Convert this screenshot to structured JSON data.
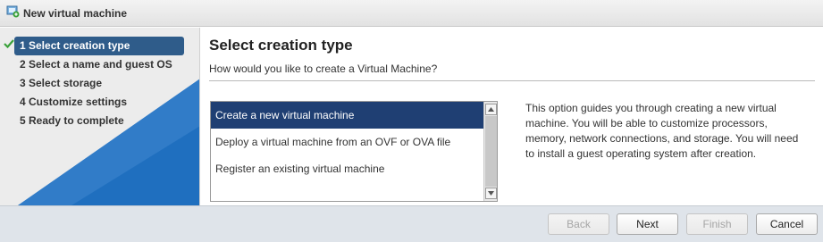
{
  "window": {
    "title": "New virtual machine",
    "icon": "new-vm-icon"
  },
  "sidebar": {
    "steps": [
      {
        "label": "1  Select creation type",
        "active": true,
        "completed": true
      },
      {
        "label": "2  Select a name and guest OS",
        "active": false
      },
      {
        "label": "3  Select storage",
        "active": false
      },
      {
        "label": "4  Customize settings",
        "active": false
      },
      {
        "label": "5  Ready to complete",
        "active": false
      }
    ]
  },
  "main": {
    "heading": "Select creation type",
    "subheading": "How would you like to create a Virtual Machine?",
    "options": [
      {
        "label": "Create a new virtual machine",
        "selected": true
      },
      {
        "label": "Deploy a virtual machine from an OVF or OVA file",
        "selected": false
      },
      {
        "label": "Register an existing virtual machine",
        "selected": false
      }
    ],
    "description": "This option guides you through creating a new virtual machine. You will be able to customize processors, memory, network connections, and storage. You will need to install a guest operating system after creation."
  },
  "footer": {
    "back_label": "Back",
    "next_label": "Next",
    "finish_label": "Finish",
    "cancel_label": "Cancel"
  },
  "colors": {
    "active_step": "#2f5c8a",
    "selected_item": "#1f3f73",
    "check": "#3aa13a",
    "sidebar_accent": "#1f6fbf"
  }
}
